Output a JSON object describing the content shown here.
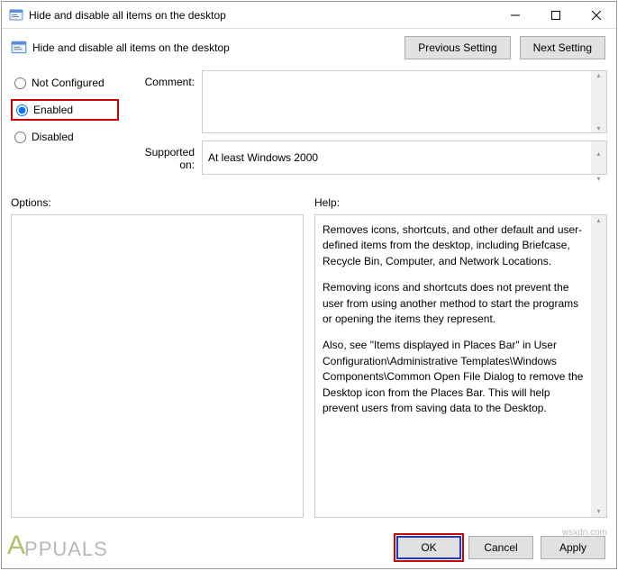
{
  "window": {
    "title": "Hide and disable all items on the desktop"
  },
  "header": {
    "title": "Hide and disable all items on the desktop",
    "prev_btn": "Previous Setting",
    "next_btn": "Next Setting"
  },
  "radios": {
    "not_configured": "Not Configured",
    "enabled": "Enabled",
    "disabled": "Disabled",
    "selected": "enabled"
  },
  "fields": {
    "comment_label": "Comment:",
    "comment_value": "",
    "supported_label": "Supported on:",
    "supported_value": "At least Windows 2000"
  },
  "panes": {
    "options_label": "Options:",
    "help_label": "Help:",
    "help_p1": "Removes icons, shortcuts, and other default and user-defined items from the desktop, including Briefcase, Recycle Bin, Computer, and Network Locations.",
    "help_p2": "Removing icons and shortcuts does not prevent the user from using another method to start the programs or opening the items they represent.",
    "help_p3": "Also, see \"Items displayed in Places Bar\" in User Configuration\\Administrative Templates\\Windows Components\\Common Open File Dialog to remove the Desktop icon from the Places Bar. This will help prevent users from saving data to the Desktop."
  },
  "footer": {
    "ok": "OK",
    "cancel": "Cancel",
    "apply": "Apply"
  },
  "watermark": {
    "brand": "PPUALS",
    "site": "wsxdn.com"
  }
}
